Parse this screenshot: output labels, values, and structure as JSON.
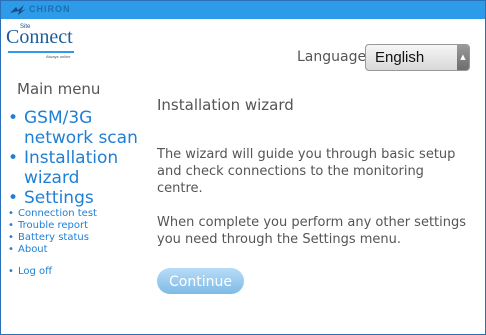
{
  "header": {
    "company": "CHIRON",
    "brand_small": "Site",
    "brand_name": "Connect",
    "brand_tagline": "Always online"
  },
  "language": {
    "label": "Language:",
    "selected": "English"
  },
  "menu": {
    "heading": "Main menu",
    "items_large": [
      {
        "label": "GSM/3G network scan"
      },
      {
        "label": "Installation wizard"
      },
      {
        "label": "Settings"
      }
    ],
    "items_small": [
      {
        "label": "Connection test"
      },
      {
        "label": "Trouble report"
      },
      {
        "label": "Battery status"
      },
      {
        "label": "About"
      }
    ],
    "logoff": "Log off"
  },
  "main": {
    "title": "Installation wizard",
    "paragraph1": "The wizard will guide you through basic setup and check connections to the monitoring centre.",
    "paragraph2": "When complete you perform any other settings you need through the Settings menu.",
    "continue_label": "Continue"
  },
  "colors": {
    "top_bar": "#2e9be8",
    "link": "#1f7fd6",
    "button": "#7dbbe6"
  }
}
